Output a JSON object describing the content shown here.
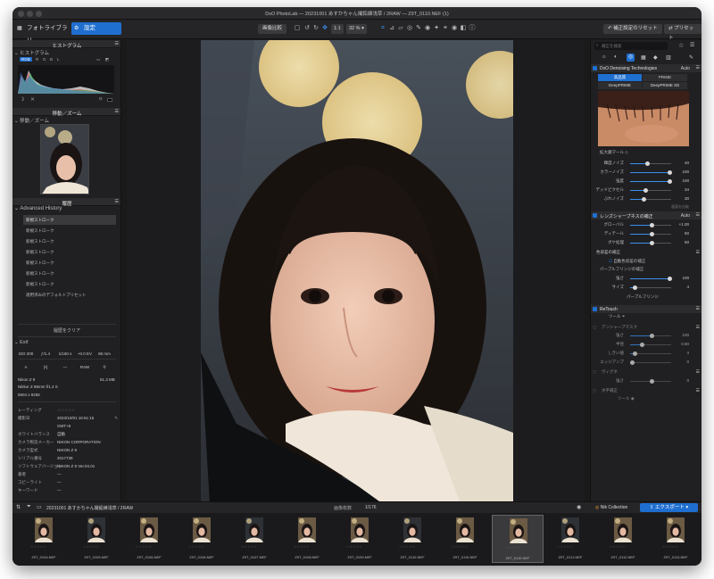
{
  "window": {
    "title": "DxO PhotoLab — 20231001 あすかちゃん撮鉛練浅草 / 2RAW — Z9T_0110.NEF (1)"
  },
  "toolbar": {
    "tab_library": "フォトライブラリ",
    "tab_customize": "設定",
    "compare_label": "画像比較",
    "zoom_label": "32 %",
    "ratio_label": "1:1",
    "reset_label": "補正設定のリセット",
    "preset_label": "プリセット"
  },
  "left": {
    "histogram_header": "ヒストグラム",
    "histogram_sub": "ヒストグラム",
    "hist_channels": [
      "RGB",
      "R",
      "G",
      "B",
      "L"
    ],
    "move_zoom_header": "移動／ズーム",
    "move_zoom_sub": "移動／ズーム",
    "history_header": "履歴",
    "history_sub": "Advanced History",
    "history_items": [
      "新規ストローク",
      "新規ストローク",
      "新規ストローク",
      "新規ストローク",
      "新規ストローク",
      "新規ストローク",
      "新規ストローク",
      "適用済みのデフォルトプリセット"
    ],
    "clear_history": "履歴をクリア",
    "exif_sub": "Exif",
    "exif_row1": [
      "ISO 200",
      "ƒ/1.4",
      "1/160 s",
      "+0.0 EV",
      "85 mm"
    ],
    "exif_row2": [
      "A",
      "[•]",
      "—",
      "RAW",
      "⚲"
    ],
    "camera": "Nikon Z 9",
    "file_size": "51.3 MB",
    "lens": "Nikkor Z 85mm f/1.2 S",
    "dimensions": "5504 x 8256",
    "meta": [
      {
        "k": "レーティング",
        "v": "☆☆☆☆☆"
      },
      {
        "k": "撮影日",
        "v": "2023/10/01 16:51:15"
      },
      {
        "k": "",
        "v": "GMT+9"
      },
      {
        "k": "ホワイトバランス",
        "v": "自動"
      },
      {
        "k": "カメラ製造メーカー",
        "v": "NIKON CORPORATION"
      },
      {
        "k": "カメラ型式",
        "v": "NIKON Z 9"
      },
      {
        "k": "シリアル番号",
        "v": "2017739"
      },
      {
        "k": "ソフトウェアバージョン",
        "v": "NIKON Z 9 Ver.04.01"
      },
      {
        "k": "著者",
        "v": "—"
      },
      {
        "k": "コピーライト",
        "v": "—"
      },
      {
        "k": "キーワード",
        "v": "—"
      }
    ]
  },
  "right": {
    "search_placeholder": "補正を検索",
    "denoise_header": "DxO Denoising Technologies",
    "denoise_auto": "Auto",
    "mode_hq": "高品質",
    "mode_prime": "PRIME",
    "mode_deepprime": "DeepPRIME",
    "mode_deepprime_xd": "DeepPRIME XD",
    "magnifier_label": "拡大鏡マール",
    "sliders_noise": [
      {
        "label": "輝度ノイズ",
        "value": "40",
        "frac": 0.4
      },
      {
        "label": "カラーノイズ",
        "value": "100",
        "frac": 1.0
      },
      {
        "label": "強度",
        "value": "100",
        "frac": 1.0
      },
      {
        "label": "デッドピクセル",
        "value": "34",
        "frac": 0.34
      },
      {
        "label": "ぶれノイズ",
        "value": "30",
        "frac": 0.3
      }
    ],
    "hide_note": "画面を比較",
    "lens_header": "レンズシャープネスの補正",
    "lens_auto": "Auto",
    "sliders_lens": [
      {
        "label": "グローバル",
        "value": "+1.00",
        "frac": 0.5
      },
      {
        "label": "ディテール",
        "value": "50",
        "frac": 0.5
      },
      {
        "label": "ボケ処理",
        "value": "50",
        "frac": 0.5
      }
    ],
    "fringe_header": "色収差の補正",
    "fringe_auto": "自動色収差の補正",
    "purple_header": "パープルフリンジの補正",
    "sliders_fringe": [
      {
        "label": "強さ",
        "value": "100",
        "frac": 1.0
      },
      {
        "label": "サイズ",
        "value": "4",
        "frac": 0.08
      }
    ],
    "purple_label": "パープルフリンジ",
    "retouch_header": "ReTouch",
    "retouch_tool": "ツール",
    "unsharp_header": "アンシャープマスク",
    "sliders_unsharp": [
      {
        "label": "強さ",
        "value": "100",
        "frac": 0.5
      },
      {
        "label": "半径",
        "value": "0.50",
        "frac": 0.25
      },
      {
        "label": "しきい値",
        "value": "4",
        "frac": 0.08
      },
      {
        "label": "エッジアンプ",
        "value": "0",
        "frac": 0.0
      }
    ],
    "vignetting_header": "ヴィグネ",
    "vig_slider": {
      "label": "強さ",
      "value": "0",
      "frac": 0.5
    },
    "horizon_header": "水平補正",
    "horizon_tool": "ツール"
  },
  "filmstrip": {
    "folder": "20231001 あすかちゃん撮鉛練浅草 / 2RAW",
    "count_label": "画像枚数",
    "count": "1/176",
    "nik_label": "Nik Collection",
    "export_label": "エクスポート",
    "items": [
      {
        "name": "Z9T_0104.NEF"
      },
      {
        "name": "Z9T_0105.NEF"
      },
      {
        "name": "Z9T_0106.NEF"
      },
      {
        "name": "Z9T_0106.NEF"
      },
      {
        "name": "Z9T_0107.NEF"
      },
      {
        "name": "Z9T_0108.NEF"
      },
      {
        "name": "Z9T_0109.NEF"
      },
      {
        "name": "Z9T_0110.NEF"
      },
      {
        "name": "Z9T_0110.NEF"
      },
      {
        "name": "Z9T_0110.NEF"
      },
      {
        "name": "Z9T_0111.NEF"
      },
      {
        "name": "Z9T_0112.NEF"
      },
      {
        "name": "Z9T_0113.NEF"
      }
    ],
    "selected_index": 9
  }
}
